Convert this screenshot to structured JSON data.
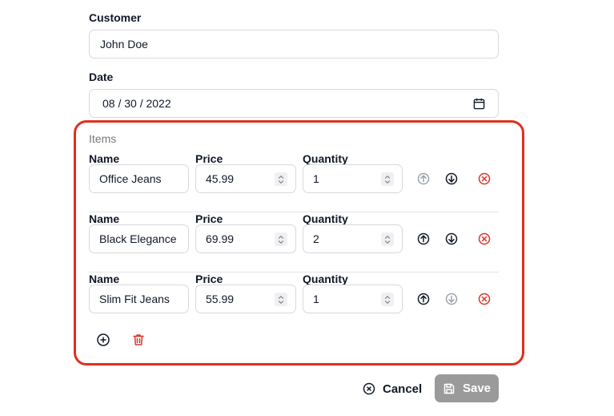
{
  "customer": {
    "label": "Customer",
    "value": "John Doe"
  },
  "date": {
    "label": "Date",
    "value": "08 / 30 / 2022"
  },
  "items": {
    "legend": "Items",
    "name_label": "Name",
    "price_label": "Price",
    "quantity_label": "Quantity",
    "rows": [
      {
        "name": "Office Jeans",
        "price": "45.99",
        "quantity": "1",
        "up_enabled": false,
        "down_enabled": true
      },
      {
        "name": "Black Elegance",
        "price": "69.99",
        "quantity": "2",
        "up_enabled": true,
        "down_enabled": true
      },
      {
        "name": "Slim Fit Jeans",
        "price": "55.99",
        "quantity": "1",
        "up_enabled": true,
        "down_enabled": false
      }
    ]
  },
  "actions": {
    "cancel_label": "Cancel",
    "save_label": "Save"
  },
  "colors": {
    "highlight": "#e0301e",
    "remove": "#d9342b",
    "save_disabled": "#9a9a9a",
    "icon_disabled": "#9ca3af"
  }
}
